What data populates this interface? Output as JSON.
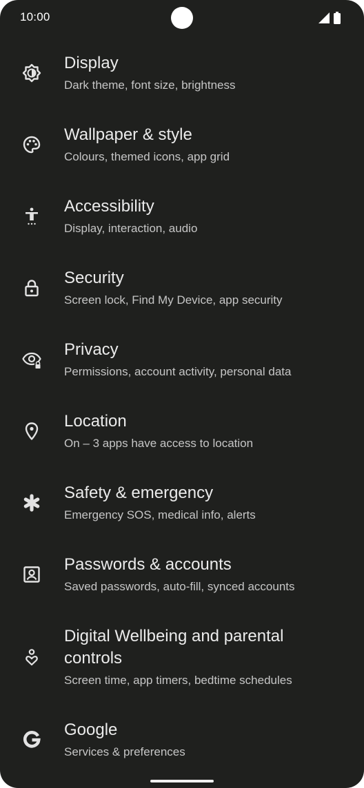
{
  "status_bar": {
    "time": "10:00",
    "icons": [
      "signal-icon",
      "battery-icon"
    ]
  },
  "settings": {
    "items": [
      {
        "title": "Display",
        "subtitle": "Dark theme, font size, brightness",
        "icon": "brightness-icon"
      },
      {
        "title": "Wallpaper & style",
        "subtitle": "Colours, themed icons, app grid",
        "icon": "palette-icon"
      },
      {
        "title": "Accessibility",
        "subtitle": "Display, interaction, audio",
        "icon": "accessibility-icon"
      },
      {
        "title": "Security",
        "subtitle": "Screen lock, Find My Device, app security",
        "icon": "lock-icon"
      },
      {
        "title": "Privacy",
        "subtitle": "Permissions, account activity, personal data",
        "icon": "eye-lock-icon"
      },
      {
        "title": "Location",
        "subtitle": "On – 3 apps have access to location",
        "icon": "location-pin-icon"
      },
      {
        "title": "Safety & emergency",
        "subtitle": "Emergency SOS, medical info, alerts",
        "icon": "asterisk-icon"
      },
      {
        "title": "Passwords & accounts",
        "subtitle": "Saved passwords, auto-fill, synced accounts",
        "icon": "account-box-icon"
      },
      {
        "title_line1": "Digital Wellbeing and parental",
        "title_line2": "controls",
        "subtitle": "Screen time, app timers, bedtime schedules",
        "icon": "wellbeing-icon"
      },
      {
        "title": "Google",
        "subtitle": "Services & preferences",
        "icon": "google-icon"
      }
    ]
  },
  "colors": {
    "background": "#1f201e",
    "title_text": "#ebebeb",
    "subtitle_text": "#c6c6c6",
    "icon": "#e3e3e3"
  }
}
